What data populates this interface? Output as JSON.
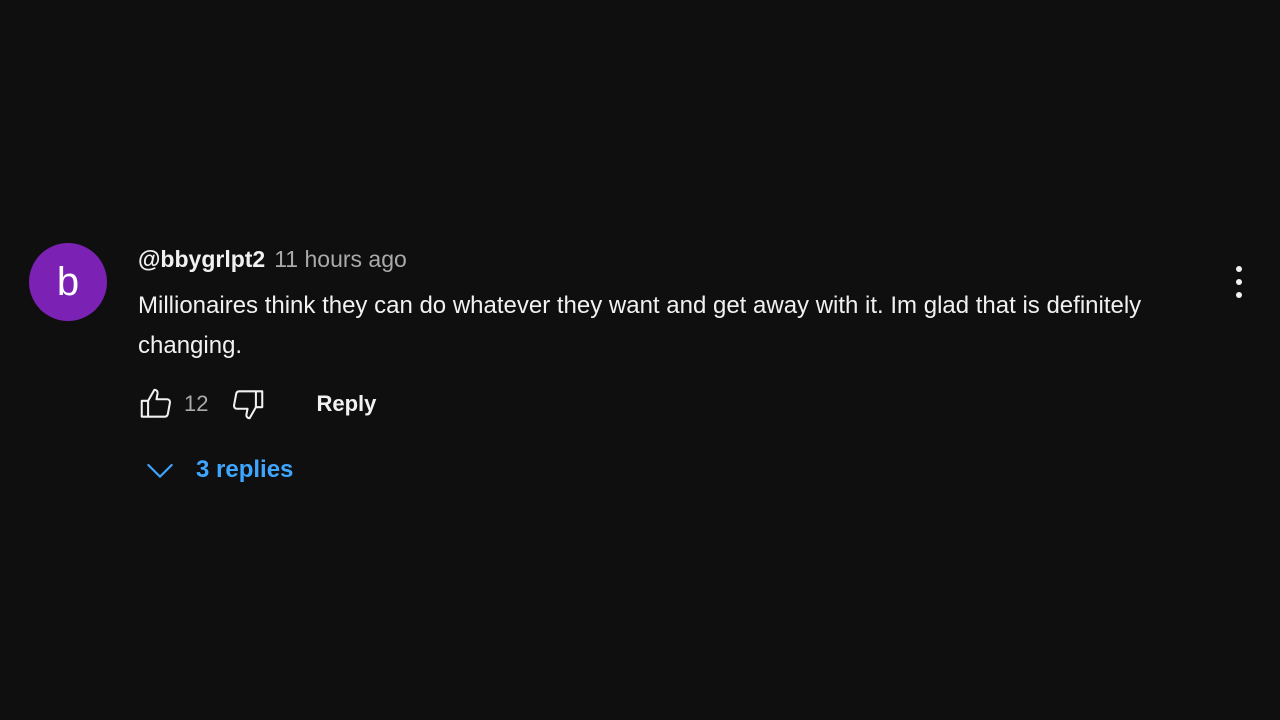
{
  "comment": {
    "avatar_letter": "b",
    "avatar_color": "#7b22b5",
    "author": "@bbygrlpt2",
    "timestamp": "11 hours ago",
    "text": "Millionaires think they can do whatever they want and get away with it. Im glad that is definitely changing.",
    "like_count": "12",
    "reply_label": "Reply",
    "replies_label": "3 replies",
    "replies_color": "#3ea6ff",
    "icons": {
      "like": "thumbs-up-icon",
      "dislike": "thumbs-down-icon",
      "expand": "chevron-down-icon",
      "menu": "more-vert-icon"
    }
  }
}
